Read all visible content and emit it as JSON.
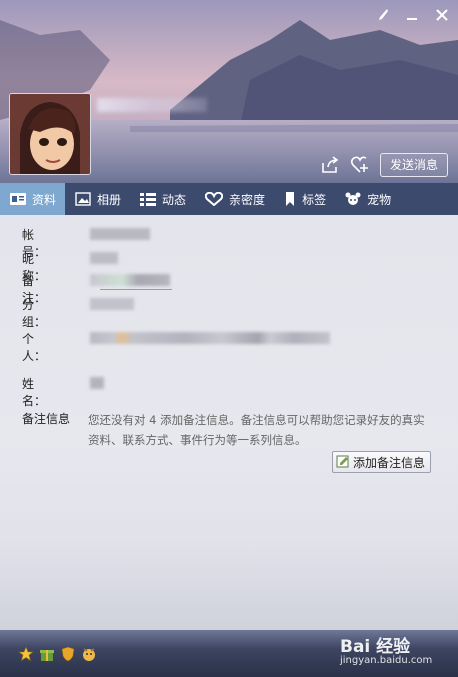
{
  "window": {
    "controls": {
      "skin": "skin-brush-icon",
      "minimize": "minimize-icon",
      "close": "close-icon"
    }
  },
  "header": {
    "send_message_label": "发送消息",
    "share_icon": "share-icon",
    "follow_icon": "heart-plus-icon"
  },
  "tabs": [
    {
      "label": "资料",
      "icon": "profile-card-icon",
      "active": true
    },
    {
      "label": "相册",
      "icon": "photo-icon",
      "active": false
    },
    {
      "label": "动态",
      "icon": "feed-list-icon",
      "active": false
    },
    {
      "label": "亲密度",
      "icon": "heart-icon",
      "active": false
    },
    {
      "label": "标签",
      "icon": "bookmark-icon",
      "active": false
    },
    {
      "label": "宠物",
      "icon": "pet-icon",
      "active": false
    }
  ],
  "profile": {
    "account_label": "帐　号：",
    "nickname_label": "昵　称：",
    "remark_label": "备　注：",
    "group_label": "分　组：",
    "personal_label": "个　人：",
    "name_label": "姓　名："
  },
  "notes": {
    "label": "备注信息",
    "text": "您还没有对 4 添加备注信息。备注信息可以帮助您记录好友的真实资料、联系方式、事件行为等一系列信息。",
    "add_button_label": "添加备注信息"
  },
  "footer": {
    "icons": [
      "star-icon",
      "gift-icon",
      "shield-icon",
      "pet-badge-icon"
    ]
  },
  "watermark": {
    "logo": "Bai 经验",
    "url": "jingyan.baidu.com"
  },
  "colors": {
    "tab_bar": "#3c4a6e",
    "tab_active": "#7ea8cf",
    "content_bg": "#e4e4ec"
  }
}
